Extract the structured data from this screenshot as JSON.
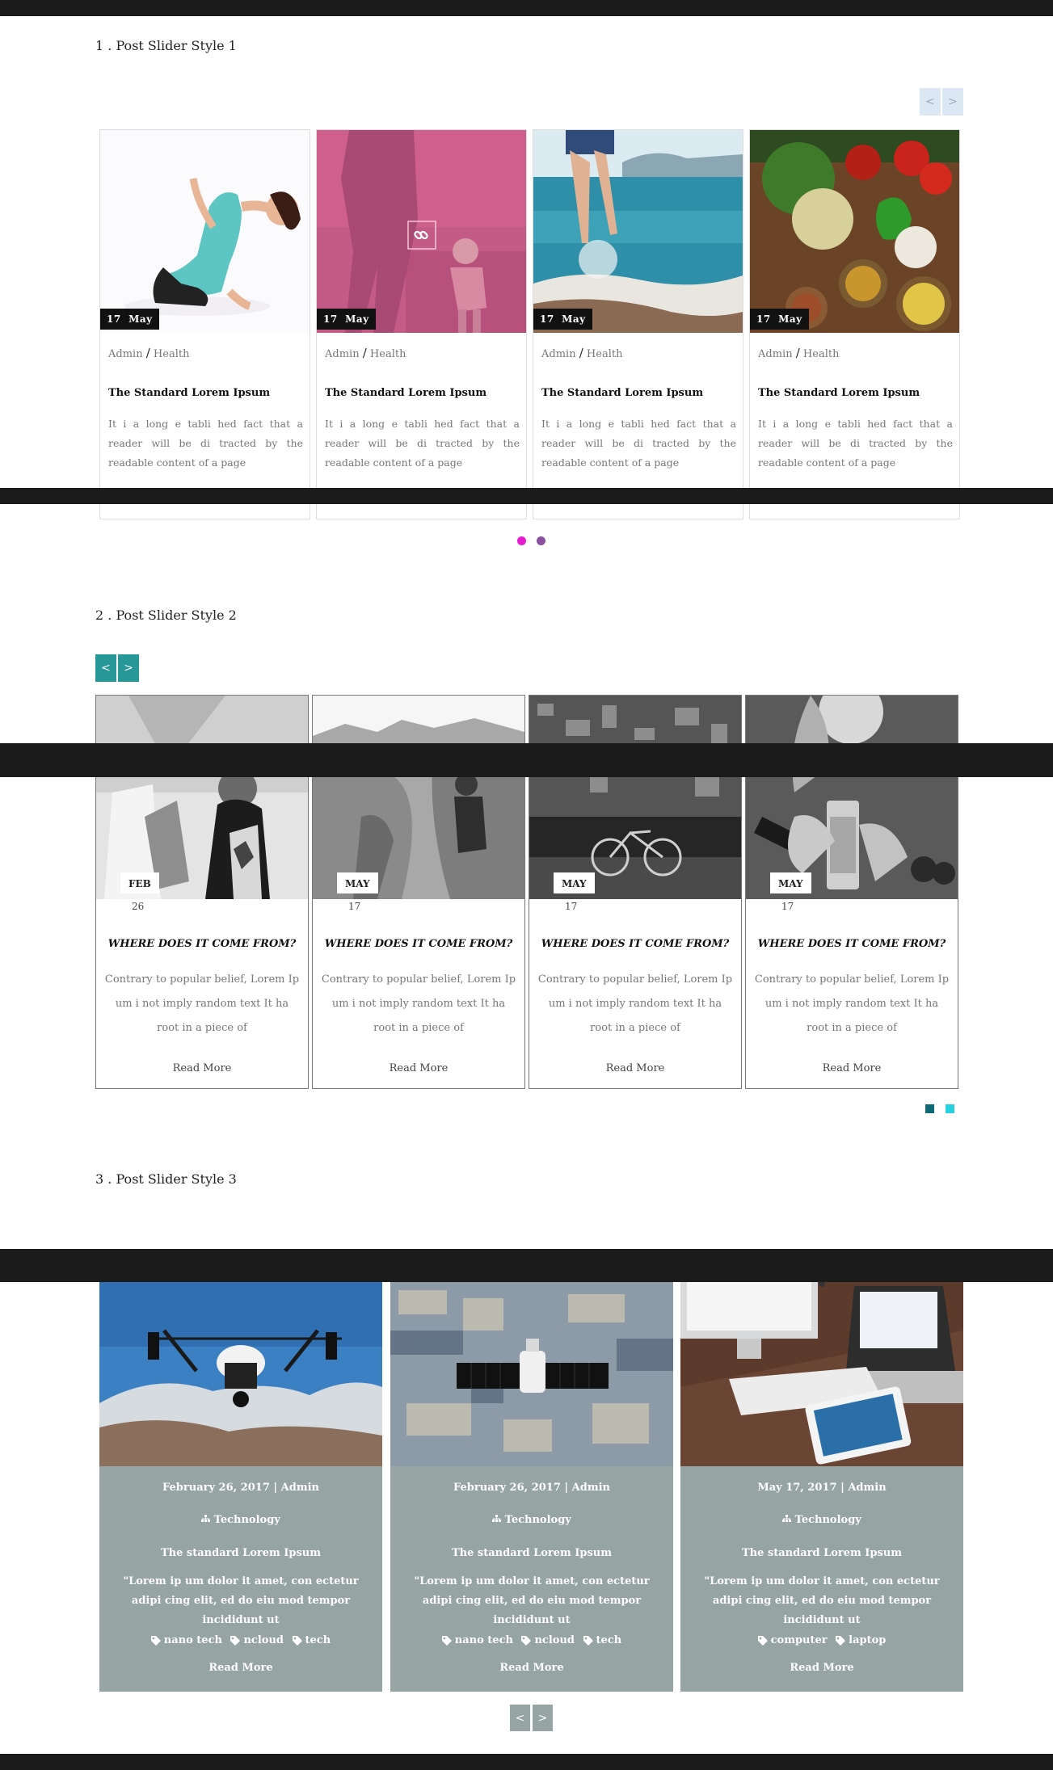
{
  "section1": {
    "title": "1 . Post Slider Style 1",
    "prev_label": "<",
    "next_label": ">",
    "cards": [
      {
        "day": "17",
        "month": "May",
        "author": "Admin",
        "category": "Health",
        "title": "The Standard Lorem Ipsum",
        "excerpt": "It i a long e tabli hed fact that a reader will be di tracted by the readable content of a page"
      },
      {
        "day": "17",
        "month": "May",
        "author": "Admin",
        "category": "Health",
        "title": "The Standard Lorem Ipsum",
        "excerpt": "It i a long e tabli hed fact that a reader will be di tracted by the readable content of a page"
      },
      {
        "day": "17",
        "month": "May",
        "author": "Admin",
        "category": "Health",
        "title": "The Standard Lorem Ipsum",
        "excerpt": "It i a long e tabli hed fact that a reader will be di tracted by the readable content of a page"
      },
      {
        "day": "17",
        "month": "May",
        "author": "Admin",
        "category": "Health",
        "title": "The Standard Lorem Ipsum",
        "excerpt": "It i a long e tabli hed fact that a reader will be di tracted by the readable content of a page"
      }
    ],
    "dots": [
      {
        "color": "#e61bd2",
        "active": true
      },
      {
        "color": "#8a4f9e",
        "active": false
      }
    ],
    "separator": "/"
  },
  "section2": {
    "title": "2 . Post Slider Style 2",
    "prev_label": "<",
    "next_label": ">",
    "accent": "#289797",
    "cards": [
      {
        "month": "FEB",
        "day": "26",
        "title": "WHERE DOES IT COME FROM?",
        "excerpt": "Contrary to popular belief, Lorem Ip um i not imply random text It ha root in a piece of",
        "more": "Read More"
      },
      {
        "month": "MAY",
        "day": "17",
        "title": "WHERE DOES IT COME FROM?",
        "excerpt": "Contrary to popular belief, Lorem Ip um i not imply random text It ha root in a piece of",
        "more": "Read More"
      },
      {
        "month": "MAY",
        "day": "17",
        "title": "WHERE DOES IT COME FROM?",
        "excerpt": "Contrary to popular belief, Lorem Ip um i not imply random text It ha root in a piece of",
        "more": "Read More"
      },
      {
        "month": "MAY",
        "day": "17",
        "title": "WHERE DOES IT COME FROM?",
        "excerpt": "Contrary to popular belief, Lorem Ip um i not imply random text It ha root in a piece of",
        "more": "Read More"
      }
    ],
    "dots": [
      {
        "color": "#0e6b75",
        "active": true
      },
      {
        "color": "#28d1e1",
        "active": false
      }
    ]
  },
  "section3": {
    "title": "3 . Post Slider Style 3",
    "prev_label": "<",
    "next_label": ">",
    "card_color": "#96a4a4",
    "cards": [
      {
        "meta": "February 26, 2017 | Admin",
        "category": "Technology",
        "title": "The standard Lorem Ipsum",
        "quote": "\"Lorem ip um dolor it amet, con ectetur adipi cing elit, ed do eiu mod tempor incididunt ut",
        "tags": [
          "nano tech",
          "ncloud",
          "tech"
        ],
        "more": "Read More"
      },
      {
        "meta": "February 26, 2017 | Admin",
        "category": "Technology",
        "title": "The standard Lorem Ipsum",
        "quote": "\"Lorem ip um dolor it amet, con ectetur adipi cing elit, ed do eiu mod tempor incididunt ut",
        "tags": [
          "nano tech",
          "ncloud",
          "tech"
        ],
        "more": "Read More"
      },
      {
        "meta": "May 17, 2017 | Admin",
        "category": "Technology",
        "title": "The standard Lorem Ipsum",
        "quote": "\"Lorem ip um dolor it amet, con ectetur adipi cing elit, ed do eiu mod tempor incididunt ut",
        "tags": [
          "computer",
          "laptop"
        ],
        "more": "Read More"
      }
    ]
  },
  "icons": {
    "link": "link-icon",
    "category": "sitemap-icon",
    "tag": "tag-icon"
  }
}
